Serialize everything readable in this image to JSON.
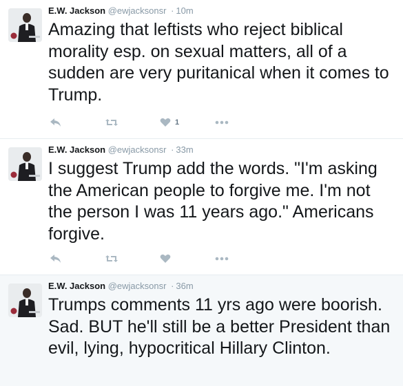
{
  "colors": {
    "name": "#14171a",
    "meta": "#8899a6",
    "icon": "#aab8c2",
    "highlight_bg": "#f5f8fa",
    "divider": "#e6ecf0"
  },
  "tweets": [
    {
      "name": "E.W. Jackson",
      "handle": "@ewjacksonsr",
      "separator": "·",
      "time": "10m",
      "text": "Amazing that leftists who reject biblical morality esp. on sexual matters, all of a sudden are very puritanical when it comes to Trump.",
      "like_count": "1",
      "icons": [
        "reply-icon",
        "retweet-icon",
        "heart-icon",
        "more-icon"
      ]
    },
    {
      "name": "E.W. Jackson",
      "handle": "@ewjacksonsr",
      "separator": "·",
      "time": "33m",
      "text": "I suggest Trump add the words. \"I'm asking the American people to forgive me. I'm not the person I was 11 years ago.\" Americans forgive.",
      "like_count": "",
      "icons": [
        "reply-icon",
        "retweet-icon",
        "heart-icon",
        "more-icon"
      ]
    },
    {
      "name": "E.W. Jackson",
      "handle": "@ewjacksonsr",
      "separator": "·",
      "time": "36m",
      "text": "Trumps comments 11 yrs ago were boorish. Sad. BUT he'll still be a better President than evil, lying, hypocritical Hillary Clinton.",
      "like_count": "",
      "icons": []
    }
  ]
}
